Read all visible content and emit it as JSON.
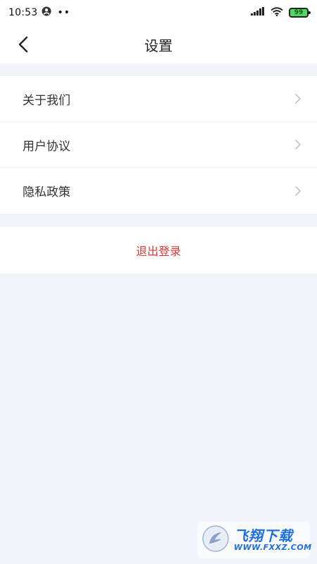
{
  "status_bar": {
    "time": "10:53",
    "extra_dots": "••",
    "battery_level": "99",
    "icons": [
      "user-circle-icon",
      "signal-icon",
      "wifi-icon",
      "battery-icon"
    ]
  },
  "nav": {
    "title": "设置",
    "back_icon": "chevron-left-icon"
  },
  "menu": {
    "items": [
      {
        "label": "关于我们"
      },
      {
        "label": "用户协议"
      },
      {
        "label": "隐私政策"
      }
    ],
    "arrow_icon": "chevron-right-icon"
  },
  "logout": {
    "label": "退出登录",
    "color": "#d63a3a"
  },
  "watermark": {
    "brand": "飞翔下载",
    "url": "WWW.FXXZ.COM",
    "color": "#1e6fd9"
  },
  "colors": {
    "page_background": "#f1f4fa",
    "card_background": "#ffffff",
    "battery_fill": "#4cd964"
  }
}
